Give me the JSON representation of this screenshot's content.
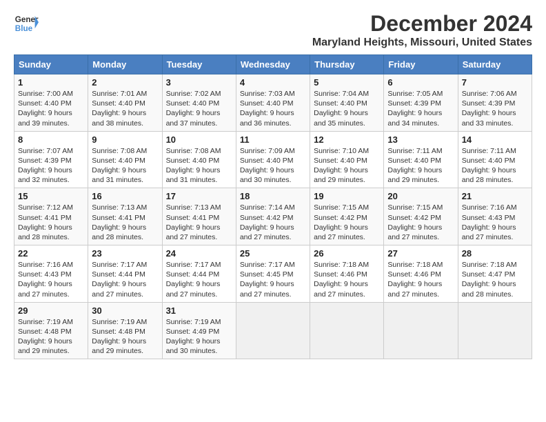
{
  "header": {
    "logo_line1": "General",
    "logo_line2": "Blue",
    "title": "December 2024",
    "subtitle": "Maryland Heights, Missouri, United States"
  },
  "weekdays": [
    "Sunday",
    "Monday",
    "Tuesday",
    "Wednesday",
    "Thursday",
    "Friday",
    "Saturday"
  ],
  "weeks": [
    [
      {
        "day": "1",
        "sunrise": "Sunrise: 7:00 AM",
        "sunset": "Sunset: 4:40 PM",
        "daylight": "Daylight: 9 hours and 39 minutes."
      },
      {
        "day": "2",
        "sunrise": "Sunrise: 7:01 AM",
        "sunset": "Sunset: 4:40 PM",
        "daylight": "Daylight: 9 hours and 38 minutes."
      },
      {
        "day": "3",
        "sunrise": "Sunrise: 7:02 AM",
        "sunset": "Sunset: 4:40 PM",
        "daylight": "Daylight: 9 hours and 37 minutes."
      },
      {
        "day": "4",
        "sunrise": "Sunrise: 7:03 AM",
        "sunset": "Sunset: 4:40 PM",
        "daylight": "Daylight: 9 hours and 36 minutes."
      },
      {
        "day": "5",
        "sunrise": "Sunrise: 7:04 AM",
        "sunset": "Sunset: 4:40 PM",
        "daylight": "Daylight: 9 hours and 35 minutes."
      },
      {
        "day": "6",
        "sunrise": "Sunrise: 7:05 AM",
        "sunset": "Sunset: 4:39 PM",
        "daylight": "Daylight: 9 hours and 34 minutes."
      },
      {
        "day": "7",
        "sunrise": "Sunrise: 7:06 AM",
        "sunset": "Sunset: 4:39 PM",
        "daylight": "Daylight: 9 hours and 33 minutes."
      }
    ],
    [
      {
        "day": "8",
        "sunrise": "Sunrise: 7:07 AM",
        "sunset": "Sunset: 4:39 PM",
        "daylight": "Daylight: 9 hours and 32 minutes."
      },
      {
        "day": "9",
        "sunrise": "Sunrise: 7:08 AM",
        "sunset": "Sunset: 4:40 PM",
        "daylight": "Daylight: 9 hours and 31 minutes."
      },
      {
        "day": "10",
        "sunrise": "Sunrise: 7:08 AM",
        "sunset": "Sunset: 4:40 PM",
        "daylight": "Daylight: 9 hours and 31 minutes."
      },
      {
        "day": "11",
        "sunrise": "Sunrise: 7:09 AM",
        "sunset": "Sunset: 4:40 PM",
        "daylight": "Daylight: 9 hours and 30 minutes."
      },
      {
        "day": "12",
        "sunrise": "Sunrise: 7:10 AM",
        "sunset": "Sunset: 4:40 PM",
        "daylight": "Daylight: 9 hours and 29 minutes."
      },
      {
        "day": "13",
        "sunrise": "Sunrise: 7:11 AM",
        "sunset": "Sunset: 4:40 PM",
        "daylight": "Daylight: 9 hours and 29 minutes."
      },
      {
        "day": "14",
        "sunrise": "Sunrise: 7:11 AM",
        "sunset": "Sunset: 4:40 PM",
        "daylight": "Daylight: 9 hours and 28 minutes."
      }
    ],
    [
      {
        "day": "15",
        "sunrise": "Sunrise: 7:12 AM",
        "sunset": "Sunset: 4:41 PM",
        "daylight": "Daylight: 9 hours and 28 minutes."
      },
      {
        "day": "16",
        "sunrise": "Sunrise: 7:13 AM",
        "sunset": "Sunset: 4:41 PM",
        "daylight": "Daylight: 9 hours and 28 minutes."
      },
      {
        "day": "17",
        "sunrise": "Sunrise: 7:13 AM",
        "sunset": "Sunset: 4:41 PM",
        "daylight": "Daylight: 9 hours and 27 minutes."
      },
      {
        "day": "18",
        "sunrise": "Sunrise: 7:14 AM",
        "sunset": "Sunset: 4:42 PM",
        "daylight": "Daylight: 9 hours and 27 minutes."
      },
      {
        "day": "19",
        "sunrise": "Sunrise: 7:15 AM",
        "sunset": "Sunset: 4:42 PM",
        "daylight": "Daylight: 9 hours and 27 minutes."
      },
      {
        "day": "20",
        "sunrise": "Sunrise: 7:15 AM",
        "sunset": "Sunset: 4:42 PM",
        "daylight": "Daylight: 9 hours and 27 minutes."
      },
      {
        "day": "21",
        "sunrise": "Sunrise: 7:16 AM",
        "sunset": "Sunset: 4:43 PM",
        "daylight": "Daylight: 9 hours and 27 minutes."
      }
    ],
    [
      {
        "day": "22",
        "sunrise": "Sunrise: 7:16 AM",
        "sunset": "Sunset: 4:43 PM",
        "daylight": "Daylight: 9 hours and 27 minutes."
      },
      {
        "day": "23",
        "sunrise": "Sunrise: 7:17 AM",
        "sunset": "Sunset: 4:44 PM",
        "daylight": "Daylight: 9 hours and 27 minutes."
      },
      {
        "day": "24",
        "sunrise": "Sunrise: 7:17 AM",
        "sunset": "Sunset: 4:44 PM",
        "daylight": "Daylight: 9 hours and 27 minutes."
      },
      {
        "day": "25",
        "sunrise": "Sunrise: 7:17 AM",
        "sunset": "Sunset: 4:45 PM",
        "daylight": "Daylight: 9 hours and 27 minutes."
      },
      {
        "day": "26",
        "sunrise": "Sunrise: 7:18 AM",
        "sunset": "Sunset: 4:46 PM",
        "daylight": "Daylight: 9 hours and 27 minutes."
      },
      {
        "day": "27",
        "sunrise": "Sunrise: 7:18 AM",
        "sunset": "Sunset: 4:46 PM",
        "daylight": "Daylight: 9 hours and 27 minutes."
      },
      {
        "day": "28",
        "sunrise": "Sunrise: 7:18 AM",
        "sunset": "Sunset: 4:47 PM",
        "daylight": "Daylight: 9 hours and 28 minutes."
      }
    ],
    [
      {
        "day": "29",
        "sunrise": "Sunrise: 7:19 AM",
        "sunset": "Sunset: 4:48 PM",
        "daylight": "Daylight: 9 hours and 29 minutes."
      },
      {
        "day": "30",
        "sunrise": "Sunrise: 7:19 AM",
        "sunset": "Sunset: 4:48 PM",
        "daylight": "Daylight: 9 hours and 29 minutes."
      },
      {
        "day": "31",
        "sunrise": "Sunrise: 7:19 AM",
        "sunset": "Sunset: 4:49 PM",
        "daylight": "Daylight: 9 hours and 30 minutes."
      },
      null,
      null,
      null,
      null
    ]
  ]
}
